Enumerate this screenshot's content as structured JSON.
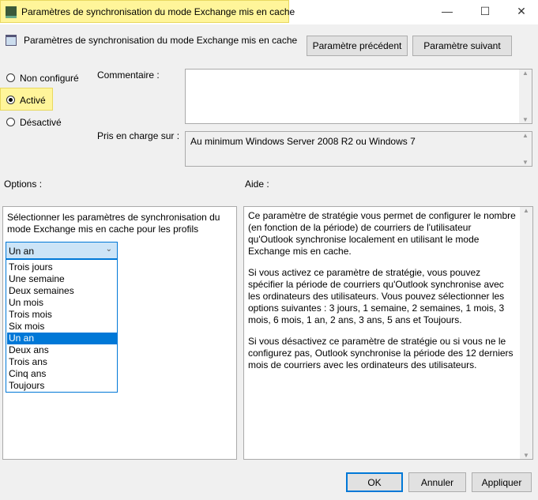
{
  "window": {
    "title": "Paramètres de synchronisation du mode Exchange mis en cache",
    "minimize": "—",
    "maximize": "☐",
    "close": "✕"
  },
  "header": {
    "title": "Paramètres de synchronisation du mode Exchange mis en cache",
    "prev_button": "Paramètre précédent",
    "next_button": "Paramètre suivant"
  },
  "state": {
    "options": [
      {
        "label": "Non configuré",
        "checked": false
      },
      {
        "label": "Activé",
        "checked": true
      },
      {
        "label": "Désactivé",
        "checked": false
      }
    ]
  },
  "comment": {
    "label": "Commentaire :",
    "value": ""
  },
  "supported": {
    "label": "Pris en charge sur :",
    "value": "Au minimum Windows Server 2008 R2 ou Windows 7"
  },
  "options_label": "Options :",
  "help_label": "Aide :",
  "options": {
    "description": "Sélectionner les paramètres de synchronisation du mode Exchange mis en cache pour les profils",
    "selected": "Un an",
    "list": [
      "Trois jours",
      "Une semaine",
      "Deux semaines",
      "Un mois",
      "Trois mois",
      "Six mois",
      "Un an",
      "Deux ans",
      "Trois ans",
      "Cinq ans",
      "Toujours"
    ],
    "selected_index": 6
  },
  "help": {
    "paragraphs": [
      "Ce paramètre de stratégie vous permet de configurer le nombre (en fonction de la période) de courriers de l'utilisateur qu'Outlook synchronise localement en utilisant le mode Exchange mis en cache.",
      "Si vous activez ce paramètre de stratégie, vous pouvez spécifier la période de courriers qu'Outlook synchronise avec les ordinateurs des utilisateurs. Vous pouvez sélectionner les options suivantes : 3 jours, 1 semaine, 2 semaines, 1 mois, 3 mois, 6 mois, 1 an, 2 ans, 3 ans, 5 ans et Toujours.",
      "Si vous désactivez ce paramètre de stratégie ou si vous ne le configurez pas, Outlook synchronise la période des 12 derniers mois de courriers avec les ordinateurs des utilisateurs."
    ]
  },
  "footer": {
    "ok": "OK",
    "cancel": "Annuler",
    "apply": "Appliquer"
  }
}
